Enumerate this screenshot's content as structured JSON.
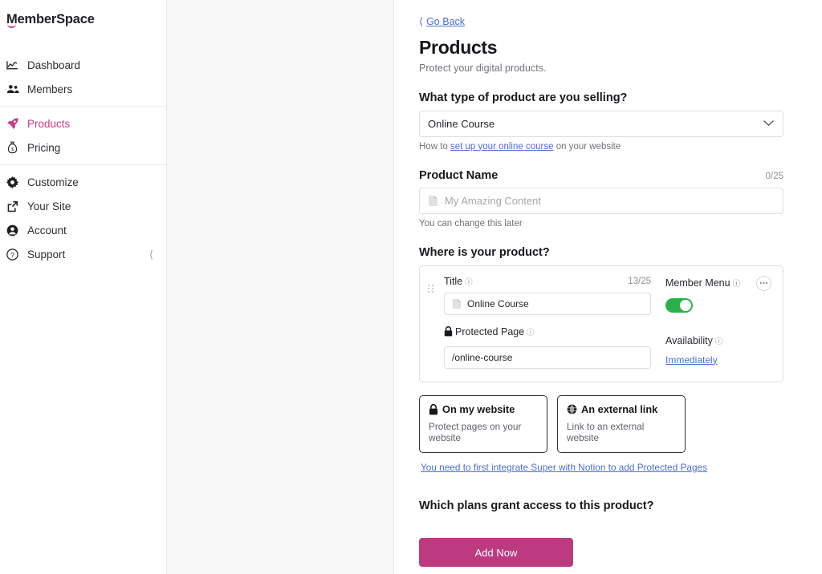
{
  "brand": {
    "name": "MemberSpace",
    "accent": "#cc3b85",
    "button_color": "#bd3a80",
    "link_color": "#4a6fd4",
    "toggle_on_color": "#2bb14b"
  },
  "sidebar": {
    "groups": [
      {
        "items": [
          {
            "label": "Dashboard",
            "icon": "chart-line-icon",
            "active": false
          },
          {
            "label": "Members",
            "icon": "people-icon",
            "active": false
          }
        ]
      },
      {
        "items": [
          {
            "label": "Products",
            "icon": "rocket-icon",
            "active": true
          },
          {
            "label": "Pricing",
            "icon": "money-bag-icon",
            "active": false
          }
        ]
      },
      {
        "items": [
          {
            "label": "Customize",
            "icon": "gear-icon",
            "active": false
          },
          {
            "label": "Your Site",
            "icon": "external-link-icon",
            "active": false
          },
          {
            "label": "Account",
            "icon": "user-circle-icon",
            "active": false
          },
          {
            "label": "Support",
            "icon": "question-circle-icon",
            "active": false,
            "trailing_icon": "chevron-left-icon"
          }
        ]
      }
    ]
  },
  "main": {
    "go_back": "Go Back",
    "title": "Products",
    "subtitle": "Protect your digital products.",
    "product_type": {
      "heading": "What type of product are you selling?",
      "selected": "Online Course",
      "options": [
        "Online Course"
      ],
      "helper_prefix": "How to ",
      "helper_link": "set up your online course",
      "helper_suffix": " on your website"
    },
    "product_name": {
      "heading": "Product Name",
      "counter": "0/25",
      "value": "",
      "placeholder": "My Amazing Content",
      "icon": "page-icon",
      "helper": "You can change this later"
    },
    "where": {
      "heading": "Where is your product?",
      "card": {
        "title_label": "Title",
        "title_counter": "13/25",
        "title_value": "Online Course",
        "title_icon": "page-icon",
        "protected_page_label": "Protected Page",
        "protected_page_icon": "lock-icon",
        "protected_page_value": "/online-course",
        "member_menu_label": "Member Menu",
        "member_menu_on": true,
        "availability_label": "Availability",
        "availability_value": "Immediately",
        "more_menu": "•••"
      },
      "tiles": [
        {
          "icon": "lock-icon",
          "title": "On my website",
          "subtitle": "Protect pages on your website"
        },
        {
          "icon": "globe-icon",
          "title": "An external link",
          "subtitle": "Link to an external website"
        }
      ],
      "warning_link": "You need to first integrate Super with Notion to add Protected Pages"
    },
    "plans": {
      "heading": "Which plans grant access to this product?"
    },
    "submit_label": "Add Now"
  }
}
